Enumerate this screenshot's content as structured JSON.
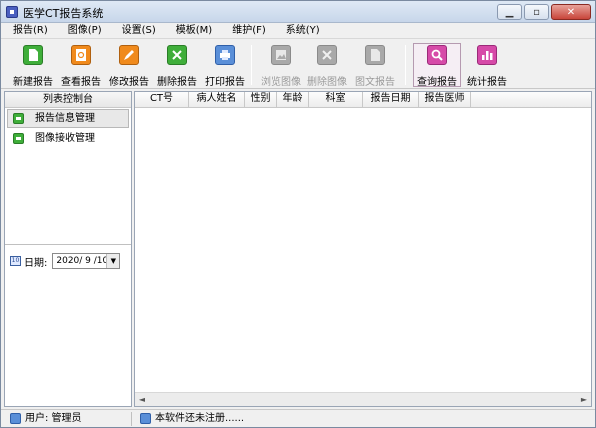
{
  "window": {
    "title": "医学CT报告系统",
    "controls": {
      "minimize": "▁",
      "maximize": "▫",
      "close": "✕"
    }
  },
  "menu": [
    "报告(R)",
    "图像(P)",
    "设置(S)",
    "模板(M)",
    "维护(F)",
    "系统(Y)"
  ],
  "toolbar": {
    "buttons": [
      {
        "label": "新建报告",
        "icon": "new-report-icon",
        "color": "#3fae3a",
        "enabled": true
      },
      {
        "label": "查看报告",
        "icon": "view-report-icon",
        "color": "#f08a1c",
        "enabled": true
      },
      {
        "label": "修改报告",
        "icon": "edit-report-icon",
        "color": "#f08a1c",
        "enabled": true
      },
      {
        "label": "删除报告",
        "icon": "delete-report-icon",
        "color": "#3fae3a",
        "enabled": true
      },
      {
        "label": "打印报告",
        "icon": "print-report-icon",
        "color": "#5a8fd8",
        "enabled": true
      },
      {
        "label": "浏览图像",
        "icon": "browse-image-icon",
        "color": "#a9a9a9",
        "enabled": false
      },
      {
        "label": "删除图像",
        "icon": "delete-image-icon",
        "color": "#a9a9a9",
        "enabled": false
      },
      {
        "label": "图文报告",
        "icon": "image-report-icon",
        "color": "#a9a9a9",
        "enabled": false
      },
      {
        "label": "查询报告",
        "icon": "search-report-icon",
        "color": "#d64aa8",
        "enabled": true,
        "active": true
      },
      {
        "label": "统计报告",
        "icon": "stats-report-icon",
        "color": "#d64aa8",
        "enabled": true
      }
    ]
  },
  "left_panel": {
    "title": "列表控制台",
    "items": [
      {
        "label": "报告信息管理",
        "selected": true
      },
      {
        "label": "图像接收管理",
        "selected": false
      }
    ],
    "date": {
      "label": "日期:",
      "value": "2020/ 9 /10",
      "icon": "calendar-icon"
    }
  },
  "grid": {
    "columns": [
      "CT号",
      "病人姓名",
      "性别",
      "年龄",
      "科室",
      "报告日期",
      "报告医师"
    ],
    "rows": []
  },
  "status_bar": {
    "user_label": "用户:  管理员",
    "message": "本软件还未注册......"
  }
}
